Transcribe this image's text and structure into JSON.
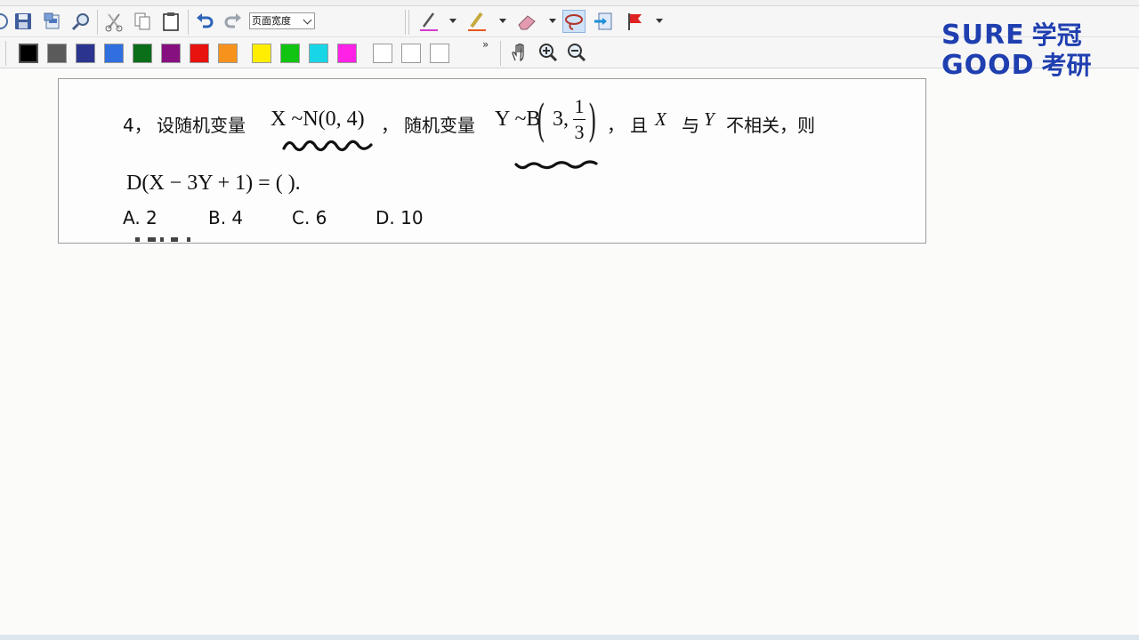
{
  "toolbar": {
    "zoom_select": {
      "selected": "页面宽度"
    },
    "more_label": "»"
  },
  "palette": {
    "colors": [
      "#000000",
      "#5a5a5a",
      "#2b3590",
      "#2f6fe0",
      "#0b6e18",
      "#861080",
      "#e8120f",
      "#f7931d",
      "#ffee00",
      "#12c412",
      "#19d6e6",
      "#ff22e6",
      "#ffffff",
      "#ffffff",
      "#ffffff"
    ],
    "selected_index": 0
  },
  "logo": {
    "line1": "SURE",
    "line1_cn": "学冠",
    "line2": "GOOD",
    "line2_cn": "考研",
    "color": "#1f3fb0"
  },
  "question": {
    "number": "4，",
    "text1": "设随机变量",
    "math1": "X ~N(0, 4)",
    "sep1": "，",
    "text2": "随机变量",
    "math2": "Y ~B",
    "math2_arg": "3,",
    "frac_num": "1",
    "frac_den": "3",
    "sep2": "，",
    "text3": "且",
    "var_x": "X",
    "text4": "与",
    "var_y": "Y",
    "text5": "不相关，则",
    "expr": "D(X − 3Y + 1) = (       )."
  },
  "options": {
    "a": "A. 2",
    "b": "B. 4",
    "c": "C. 6",
    "d": "D. 10"
  },
  "ink_color": "#111111"
}
